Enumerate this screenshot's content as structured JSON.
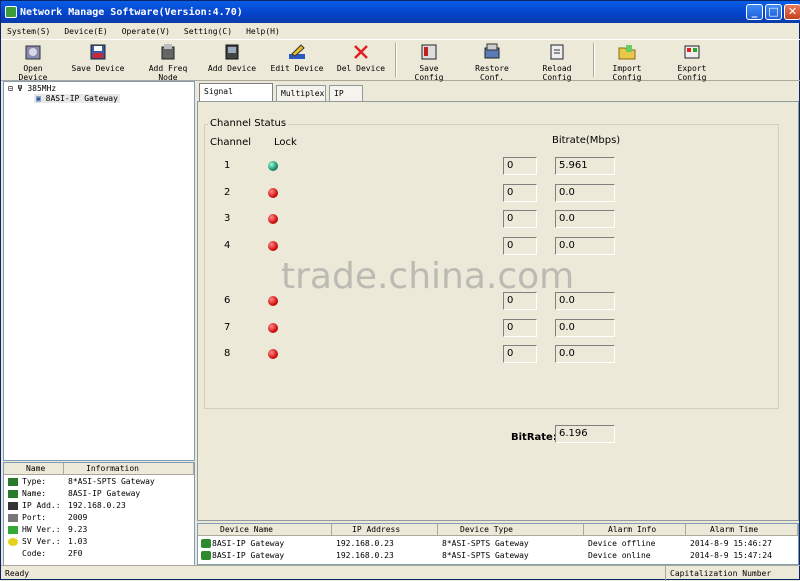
{
  "window": {
    "title": "Network Manage Software(Version:4.70)",
    "min": "_",
    "max": "□",
    "close": "✕"
  },
  "menu": [
    "System(S)",
    "Device(E)",
    "Operate(V)",
    "Setting(C)",
    "Help(H)"
  ],
  "toolbar": [
    "Open Device",
    "Save Device",
    "Add Freq Node",
    "Add Device",
    "Edit Device",
    "Del Device",
    "Save Config",
    "Restore Conf.",
    "Reload Config",
    "Import Config",
    "Export Config"
  ],
  "tree": {
    "root": "385MHz",
    "child": "8ASI-IP Gateway"
  },
  "props": {
    "headers": [
      "Name",
      "Information"
    ],
    "rows": [
      {
        "label": "Type:",
        "value": "8*ASI-SPTS Gateway"
      },
      {
        "label": "Name:",
        "value": "8ASI-IP Gateway"
      },
      {
        "label": "IP Add.:",
        "value": "192.168.0.23"
      },
      {
        "label": "Port:",
        "value": "2009"
      },
      {
        "label": "HW Ver.:",
        "value": "9.23"
      },
      {
        "label": "SV Ver.:",
        "value": "1.03"
      },
      {
        "label": "Code:",
        "value": "2F0"
      }
    ]
  },
  "tabs": [
    "Signal Monitor",
    "Multiplex",
    "IP Out"
  ],
  "channel_status": {
    "title": "Channel Status",
    "col_channel": "Channel",
    "col_lock": "Lock",
    "col_bitrate": "Bitrate(Mbps)",
    "rows": [
      {
        "ch": "1",
        "lock": "on",
        "count": "0",
        "bitrate": "5.961"
      },
      {
        "ch": "2",
        "lock": "off",
        "count": "0",
        "bitrate": "0.0"
      },
      {
        "ch": "3",
        "lock": "off",
        "count": "0",
        "bitrate": "0.0"
      },
      {
        "ch": "4",
        "lock": "off",
        "count": "0",
        "bitrate": "0.0"
      },
      {
        "ch": "6",
        "lock": "off",
        "count": "0",
        "bitrate": "0.0"
      },
      {
        "ch": "7",
        "lock": "off",
        "count": "0",
        "bitrate": "0.0"
      },
      {
        "ch": "8",
        "lock": "off",
        "count": "0",
        "bitrate": "0.0"
      }
    ],
    "total_label": "BitRate:",
    "total_value": "6.196"
  },
  "alarm": {
    "headers": [
      "Device Name",
      "IP Address",
      "Device Type",
      "Alarm Info",
      "Alarm Time"
    ],
    "rows": [
      [
        "8ASI-IP Gateway",
        "192.168.0.23",
        "8*ASI-SPTS Gateway",
        "Device offline",
        "2014-8-9 15:46:27"
      ],
      [
        "8ASI-IP Gateway",
        "192.168.0.23",
        "8*ASI-SPTS Gateway",
        "Device online",
        "2014-8-9 15:47:24"
      ]
    ]
  },
  "status": {
    "left": "Ready",
    "right": "Capitalization Number"
  },
  "watermark": "trade.china.com",
  "colors": {
    "lock_on": "#1a8a6a",
    "lock_off": "#d01010",
    "titlebar": "#0a5de6"
  }
}
